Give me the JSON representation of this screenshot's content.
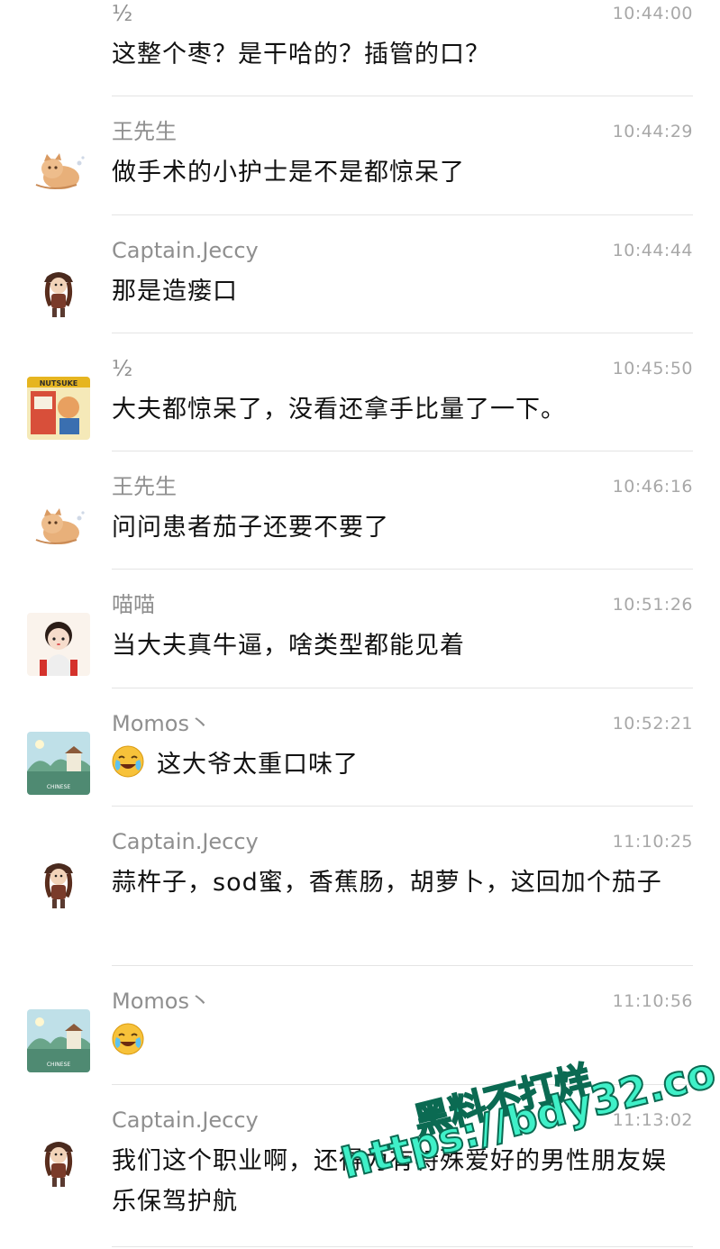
{
  "messages": [
    {
      "name": "½",
      "time": "10:44:00",
      "text": "这整个枣？是干哈的？插管的口？",
      "avatar": "none"
    },
    {
      "name": "王先生",
      "time": "10:44:29",
      "text": "做手术的小护士是不是都惊呆了",
      "avatar": "cat"
    },
    {
      "name": "Captain.Jeccy",
      "time": "10:44:44",
      "text": "那是造瘘口",
      "avatar": "pirate"
    },
    {
      "name": "½",
      "time": "10:45:50",
      "text": "大夫都惊呆了，没看还拿手比量了一下。",
      "avatar": "comic"
    },
    {
      "name": "王先生",
      "time": "10:46:16",
      "text": "问问患者茄子还要不要了",
      "avatar": "cat"
    },
    {
      "name": "喵喵",
      "time": "10:51:26",
      "text": "当大夫真牛逼，啥类型都能见着",
      "avatar": "girl"
    },
    {
      "name": "Momos丶",
      "time": "10:52:21",
      "text": "这大爷太重口味了",
      "avatar": "landscape",
      "emoji": "laugh-cry-emoji"
    },
    {
      "name": "Captain.Jeccy",
      "time": "11:10:25",
      "text": "蒜杵子，sod蜜，香蕉肠，胡萝卜，这回加个茄子",
      "avatar": "pirate"
    },
    {
      "name": "Momos丶",
      "time": "11:10:56",
      "text": "",
      "avatar": "landscape",
      "emoji": "laugh-cry-emoji"
    },
    {
      "name": "Captain.Jeccy",
      "time": "11:13:02",
      "text": "我们这个职业啊，还得为有特殊爱好的男性朋友娱乐保驾护航",
      "avatar": "pirate"
    }
  ],
  "watermark": {
    "line1": "黑料不打烊",
    "line2": "https://bdy32.co"
  }
}
